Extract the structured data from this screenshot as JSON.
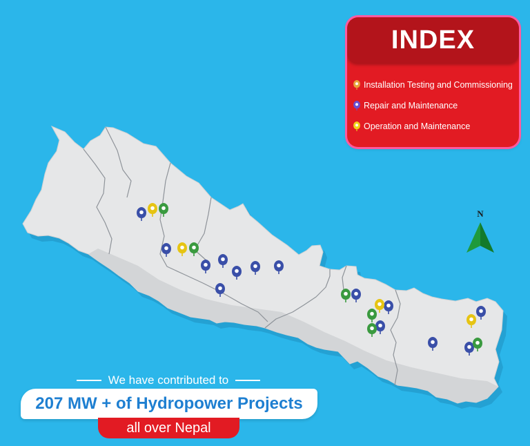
{
  "index": {
    "title": "INDEX",
    "items": [
      {
        "label": "Installation Testing and Commissioning",
        "icon": "green-location-pin-icon",
        "color": "#3a9a3f"
      },
      {
        "label": "Repair and Maintenance",
        "icon": "blue-location-pin-icon",
        "color": "#3a4fa8"
      },
      {
        "label": "Operation and Maintenance",
        "icon": "yellow-location-pin-icon",
        "color": "#e6c413"
      }
    ]
  },
  "compass": {
    "label": "N"
  },
  "summary": {
    "line1": "We have contributed to",
    "line2": "207 MW + of Hydropower Projects",
    "line3": "all over Nepal"
  },
  "colors": {
    "background": "#2bb6ea",
    "map_fill": "#e6e7e8",
    "accent_red": "#e21b23",
    "headline_blue": "#1e7fd1"
  }
}
